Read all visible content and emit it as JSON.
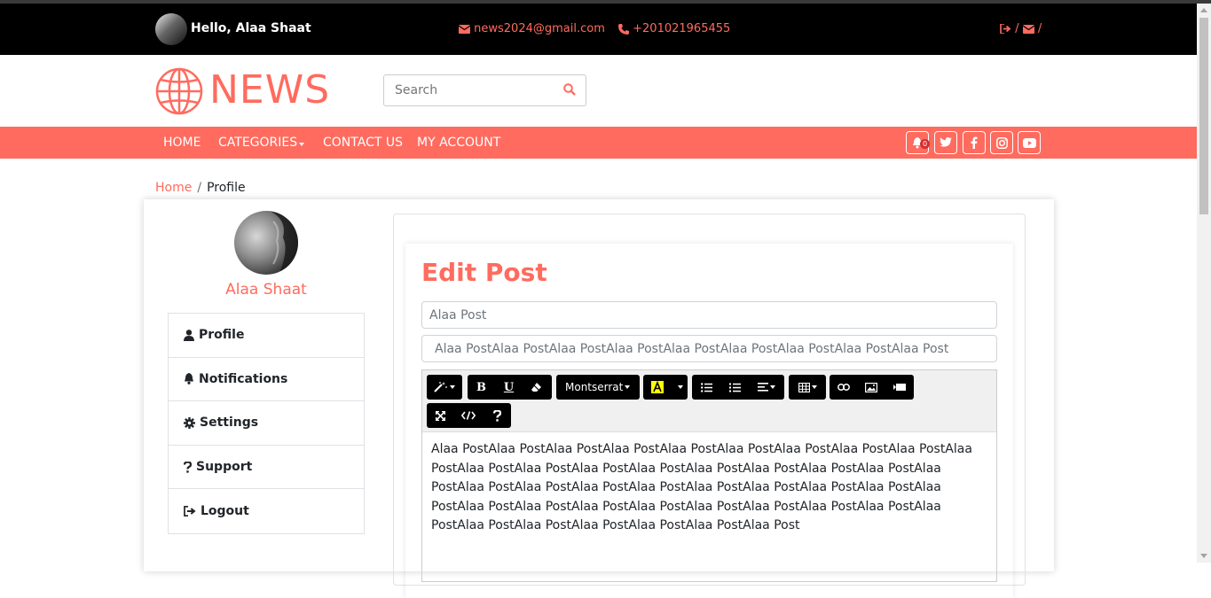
{
  "topbar": {
    "greeting": "Hello, Alaa Shaat",
    "email": "news2024@gmail.com",
    "phone": "+201021965455",
    "sep1": "/",
    "sep2": "/"
  },
  "brand": {
    "logo_text": "NEWS"
  },
  "search": {
    "placeholder": "Search"
  },
  "nav": {
    "items": [
      "HOME",
      "CATEGORIES",
      "CONTACT US",
      "MY ACCOUNT"
    ],
    "notification_count": "0"
  },
  "breadcrumb": {
    "home": "Home",
    "sep": "/",
    "current": "Profile"
  },
  "profile": {
    "name": "Alaa Shaat"
  },
  "menu": {
    "items": [
      {
        "label": "Profile",
        "icon": "user-icon"
      },
      {
        "label": "Notifications",
        "icon": "bell-icon"
      },
      {
        "label": "Settings",
        "icon": "gear-icon"
      },
      {
        "label": "Support",
        "icon": "question-icon"
      },
      {
        "label": "Logout",
        "icon": "logout-icon"
      }
    ]
  },
  "edit": {
    "title": "Edit Post",
    "title_field": "Alaa Post",
    "subtitle_field": "Alaa PostAlaa PostAlaa PostAlaa PostAlaa PostAlaa PostAlaa PostAlaa PostAlaa Post",
    "font_select": "Montserrat",
    "body": "Alaa PostAlaa PostAlaa PostAlaa PostAlaa PostAlaa PostAlaa PostAlaa PostAlaa PostAlaa PostAlaa PostAlaa PostAlaa PostAlaa PostAlaa PostAlaa PostAlaa PostAlaa PostAlaa PostAlaa PostAlaa PostAlaa PostAlaa PostAlaa PostAlaa PostAlaa PostAlaa PostAlaa PostAlaa PostAlaa PostAlaa PostAlaa PostAlaa PostAlaa PostAlaa PostAlaa PostAlaa PostAlaa PostAlaa PostAlaa PostAlaa PostAlaa PostAlaa Post"
  },
  "colors": {
    "accent": "#ff6b5e",
    "topbar": "#000000"
  }
}
